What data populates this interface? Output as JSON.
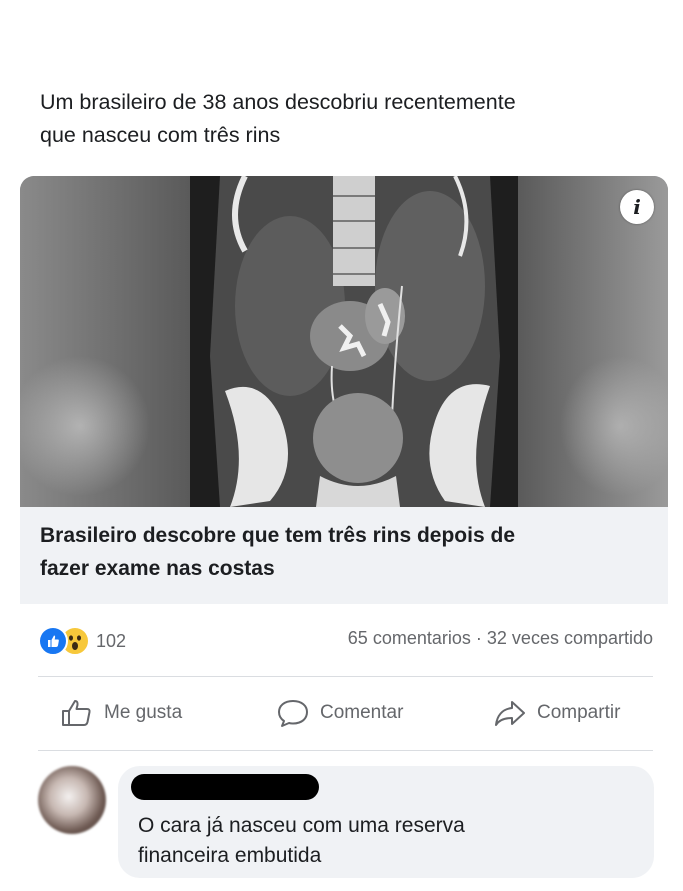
{
  "post": {
    "text_lines": [
      "Um brasileiro de 38 anos descobriu recentemente",
      "que nasceu com três rins"
    ]
  },
  "link_preview": {
    "image_description_icon": "info-icon",
    "title_lines": [
      "Brasileiro descobre que tem três rins depois de",
      "fazer exame nas costas"
    ]
  },
  "stats": {
    "reactions": [
      "like-reaction-icon",
      "wow-reaction-icon"
    ],
    "reaction_count": "102",
    "comments": "65 comentarios",
    "separator": "·",
    "shares": "32 veces compartido"
  },
  "actions": {
    "like": "Me gusta",
    "comment": "Comentar",
    "share": "Compartir"
  },
  "comment": {
    "text_lines": [
      "O cara já nasceu com uma reserva",
      "financeira embutida"
    ]
  },
  "colors": {
    "like_blue": "#1877f2",
    "wow_yellow": "#f7c83b",
    "secondary_text": "#65676b",
    "card_bg": "#f0f2f5"
  }
}
